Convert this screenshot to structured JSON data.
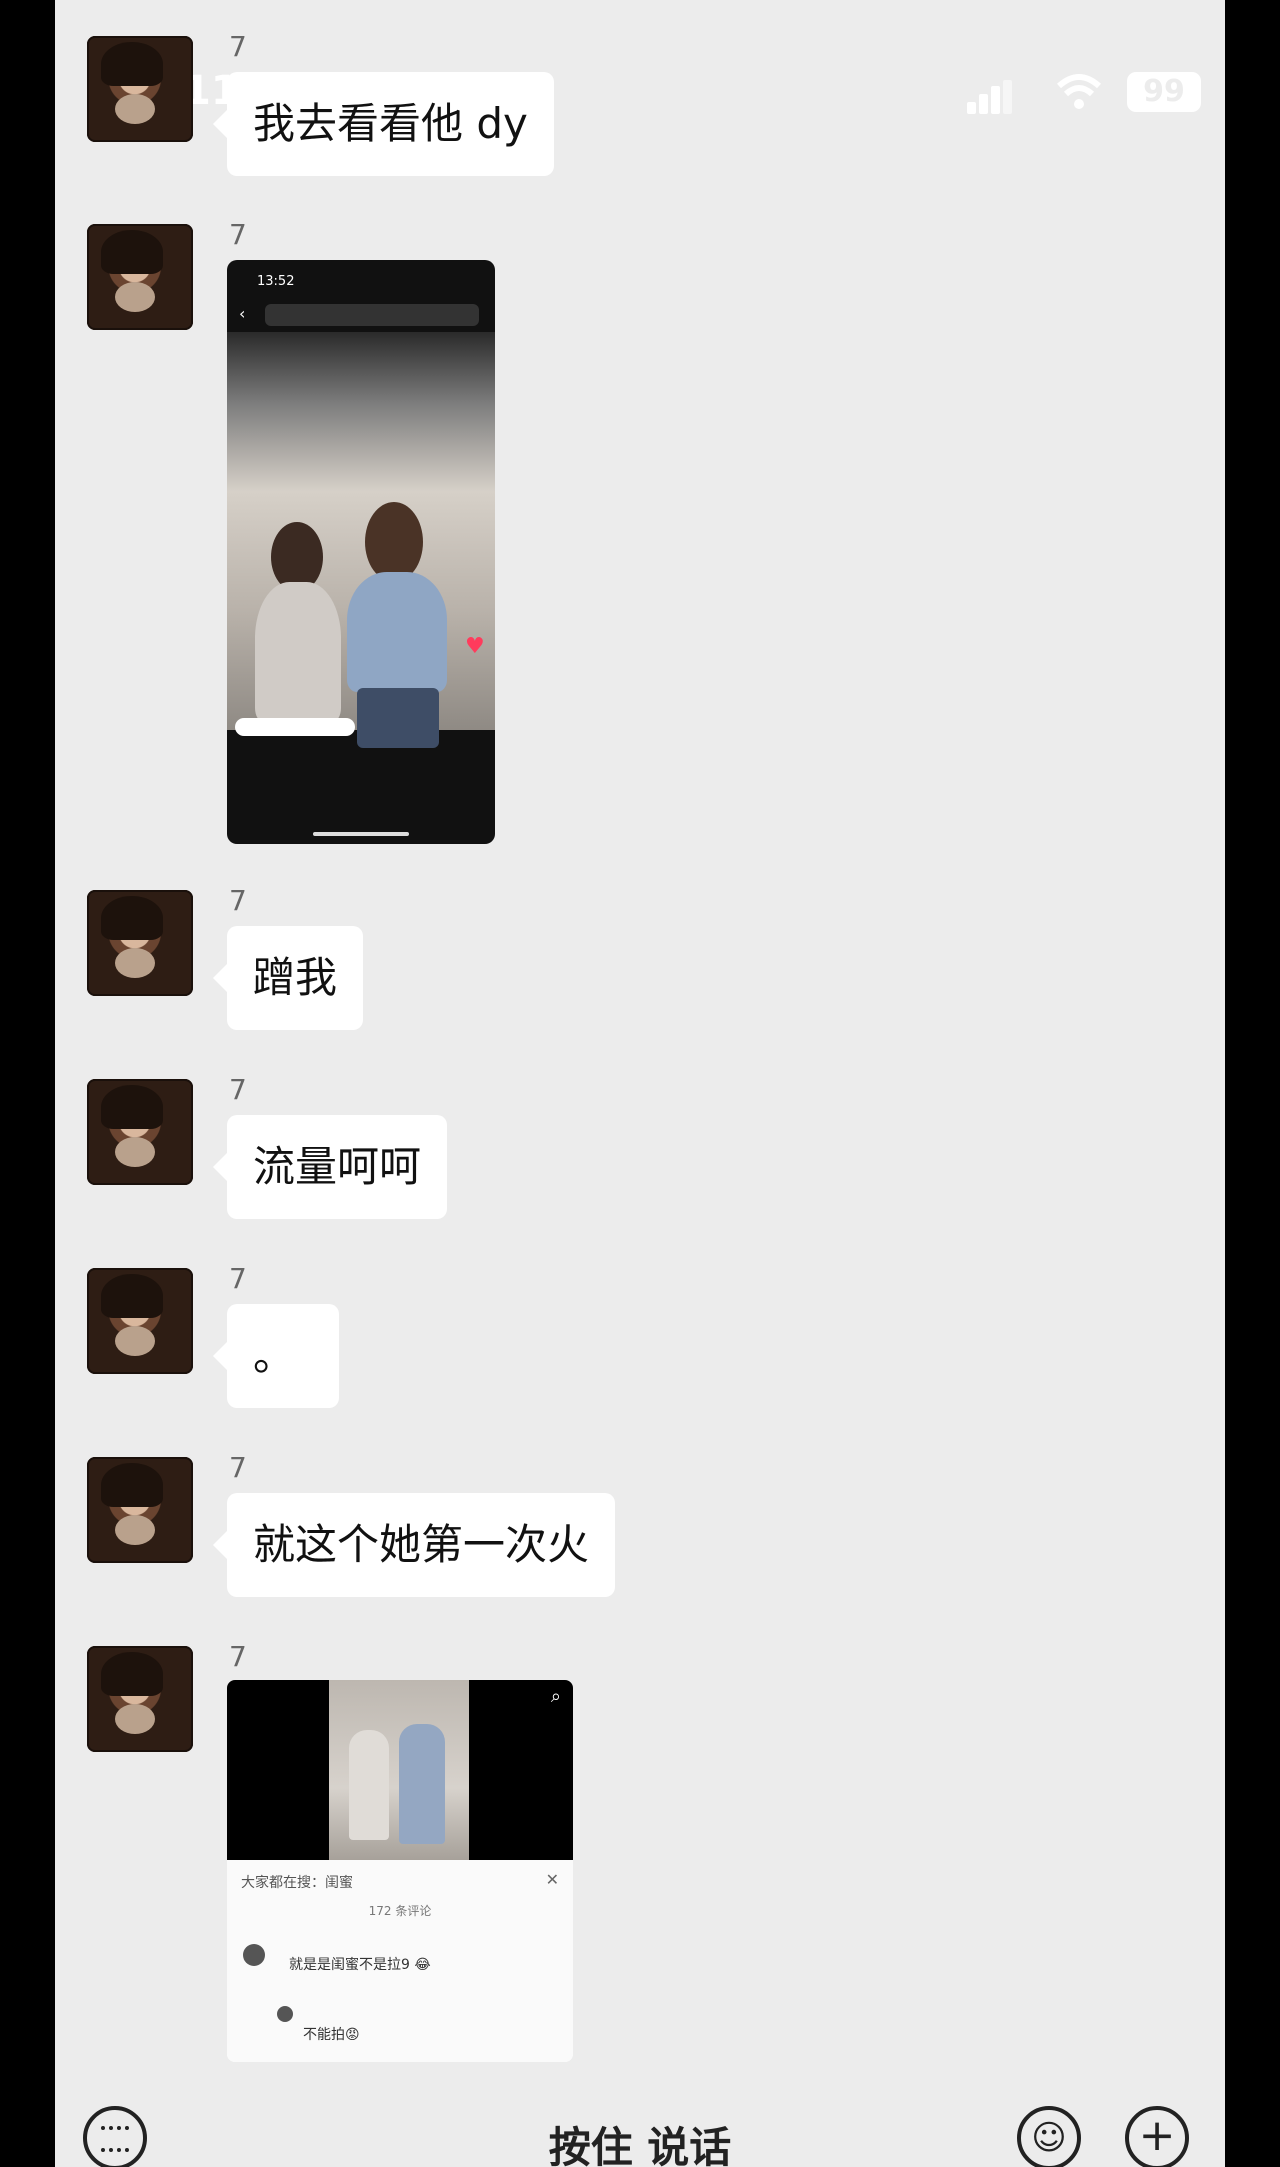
{
  "status_bar": {
    "time": "11",
    "battery": "99"
  },
  "messages": [
    {
      "sender": "7",
      "text": "我去看看他 dy"
    },
    {
      "sender": "7",
      "image": "video-screenshot"
    },
    {
      "sender": "7",
      "text": "蹭我"
    },
    {
      "sender": "7",
      "text": "流量呵呵"
    },
    {
      "sender": "7",
      "text": "。"
    },
    {
      "sender": "7",
      "text": "就这个她第一次火"
    },
    {
      "sender": "7",
      "image": "comment-screenshot"
    }
  ],
  "screenshot1": {
    "time": "13:52"
  },
  "screenshot2": {
    "panel_title": "大家都在搜：闺蜜",
    "comment_count": "172 条评论",
    "comment1": "就是是闺蜜不是拉9 😂",
    "comment2": "不能拍😡"
  },
  "bottom_bar": {
    "hold_to_talk": "按住 说话"
  }
}
